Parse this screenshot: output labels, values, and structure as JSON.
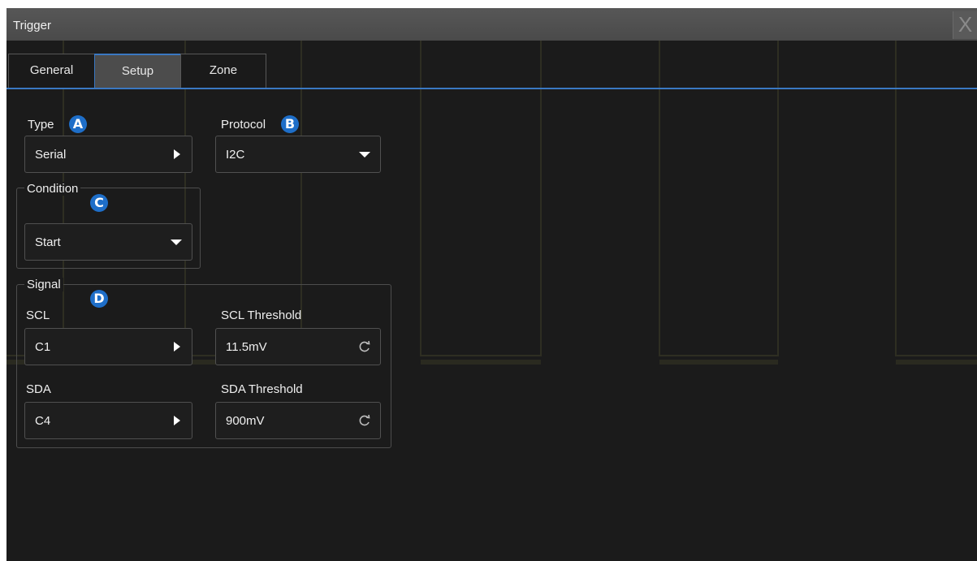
{
  "window": {
    "title": "Trigger",
    "close_glyph": "X"
  },
  "tabs": [
    {
      "label": "General"
    },
    {
      "label": "Setup",
      "active": true
    },
    {
      "label": "Zone"
    }
  ],
  "setup": {
    "type": {
      "label": "Type",
      "marker": "A",
      "value": "Serial",
      "icon": "triangle-right-icon"
    },
    "protocol": {
      "label": "Protocol",
      "marker": "B",
      "value": "I2C",
      "icon": "triangle-down-icon"
    },
    "condition": {
      "label": "Condition",
      "marker": "C",
      "value": "Start",
      "icon": "triangle-down-icon"
    },
    "signal": {
      "label": "Signal",
      "marker": "D",
      "scl": {
        "label": "SCL",
        "value": "C1",
        "icon": "triangle-right-icon"
      },
      "scl_threshold": {
        "label": "SCL Threshold",
        "value": "11.5mV",
        "icon": "reset-icon"
      },
      "sda": {
        "label": "SDA",
        "value": "C4",
        "icon": "triangle-right-icon"
      },
      "sda_threshold": {
        "label": "SDA Threshold",
        "value": "900mV",
        "icon": "reset-icon"
      }
    }
  },
  "colors": {
    "accent": "#3a78c2",
    "marker": "#1e6ec8",
    "background": "#1b1b1b"
  }
}
